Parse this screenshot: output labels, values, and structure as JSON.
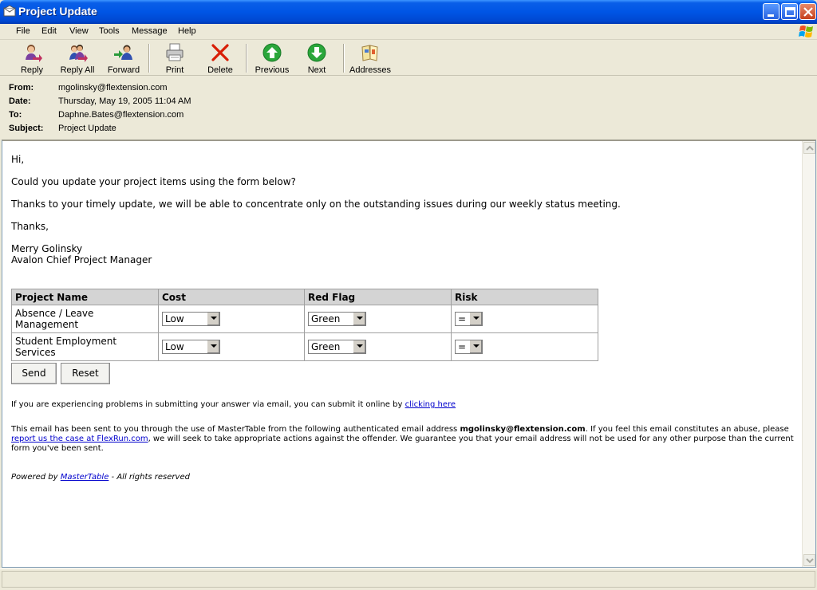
{
  "window": {
    "title": "Project Update"
  },
  "menu": [
    "File",
    "Edit",
    "View",
    "Tools",
    "Message",
    "Help"
  ],
  "toolbar": {
    "reply": "Reply",
    "reply_all": "Reply All",
    "forward": "Forward",
    "print": "Print",
    "delete": "Delete",
    "previous": "Previous",
    "next": "Next",
    "addresses": "Addresses"
  },
  "headers": {
    "from_label": "From:",
    "from": "mgolinsky@flextension.com",
    "date_label": "Date:",
    "date": "Thursday, May 19, 2005 11:04 AM",
    "to_label": "To:",
    "to": "Daphne.Bates@flextension.com",
    "subject_label": "Subject:",
    "subject": "Project Update"
  },
  "message": {
    "greeting": "Hi,",
    "line1": "Could you update your project items using the form below?",
    "line2": "Thanks to your timely update, we will be able to concentrate only on the outstanding issues during our weekly status meeting.",
    "closing": "Thanks,",
    "sender_name": "Merry Golinsky",
    "sender_title": "Avalon Chief Project Manager"
  },
  "form": {
    "columns": [
      "Project Name",
      "Cost",
      "Red Flag",
      "Risk"
    ],
    "rows": [
      {
        "project": "Absence / Leave Management",
        "cost": "Low",
        "red_flag": "Green",
        "risk": "="
      },
      {
        "project": "Student Employment Services",
        "cost": "Low",
        "red_flag": "Green",
        "risk": "="
      }
    ],
    "send": "Send",
    "reset": "Reset"
  },
  "footer": {
    "problem_text": "If you are experiencing problems in submitting your answer via email, you can submit it online by",
    "problem_link": "clicking here",
    "notice_1": "This email has been sent to you through the use of MasterTable from the following authenticated email address",
    "notice_email": "mgolinsky@flextension.com",
    "notice_2": ". If you feel this email constitutes an abuse, please",
    "notice_link": "report us the case at FlexRun.com",
    "notice_3": ", we will seek to take appropriate actions against the offender. We guarantee you that your email address will not be used for any other purpose than the current form you've been sent.",
    "powered_prefix": "Powered by",
    "powered_link": "MasterTable",
    "powered_suffix": "- All rights reserved"
  }
}
